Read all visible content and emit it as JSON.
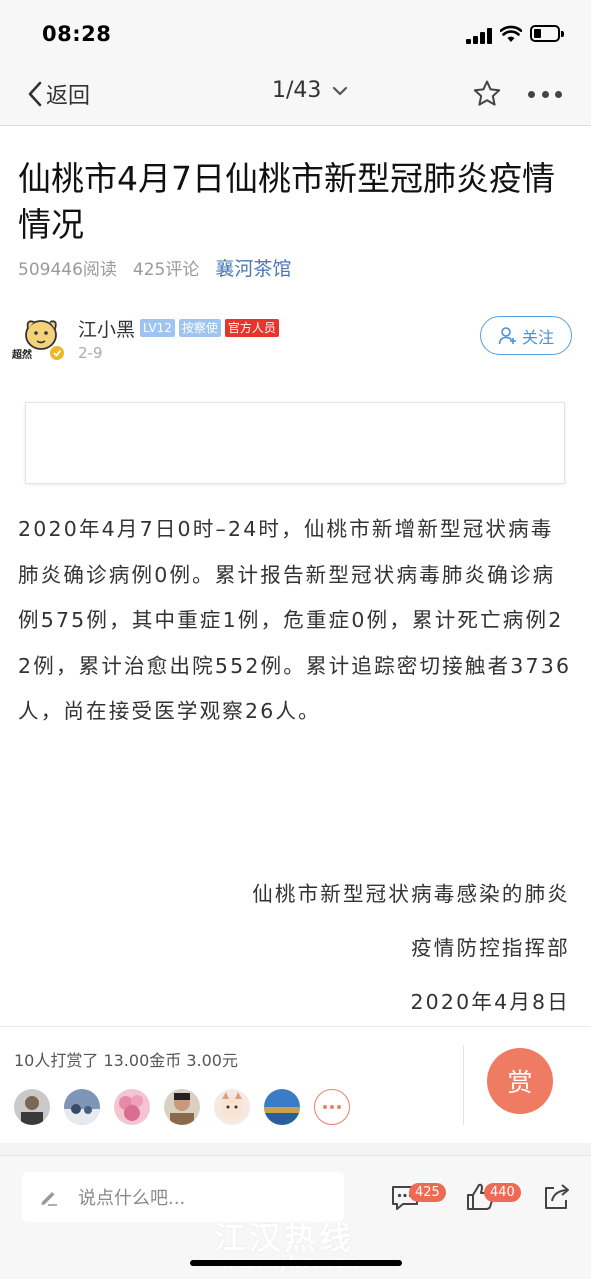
{
  "status_bar": {
    "time": "08:28"
  },
  "nav": {
    "back_label": "返回",
    "page_indicator": "1/43"
  },
  "article": {
    "title": "仙桃市4月7日仙桃市新型冠肺炎疫情情况",
    "reads": "509446阅读",
    "comments": "425评论",
    "channel": "襄河茶馆"
  },
  "author": {
    "name": "江小黑",
    "level": "LV12",
    "role_badge": "按察使",
    "official_badge": "官方人员",
    "date": "2-9",
    "avatar_text": "超然",
    "follow_label": "关注"
  },
  "body": {
    "paragraph": "2020年4月7日0时–24时，仙桃市新增新型冠状病毒肺炎确诊病例0例。累计报告新型冠状病毒肺炎确诊病例575例，其中重症1例，危重症0例，累计死亡病例22例，累计治愈出院552例。累计追踪密切接触者3736人，尚在接受医学观察26人。",
    "sign_line1": "仙桃市新型冠状病毒感染的肺炎",
    "sign_line2": "疫情防控指挥部",
    "sign_date": "2020年4月8日"
  },
  "reward": {
    "summary": "10人打赏了 13.00金币 3.00元",
    "button_label": "赏"
  },
  "bottom": {
    "comment_placeholder": "说点什么吧...",
    "comment_count": "425",
    "like_count": "440",
    "watermark": "江汉热线",
    "watermark_url": "www.jhrx.cn"
  },
  "colors": {
    "accent_blue": "#4a90dd",
    "reward_orange": "#ef7b63",
    "official_red": "#e8352c"
  }
}
